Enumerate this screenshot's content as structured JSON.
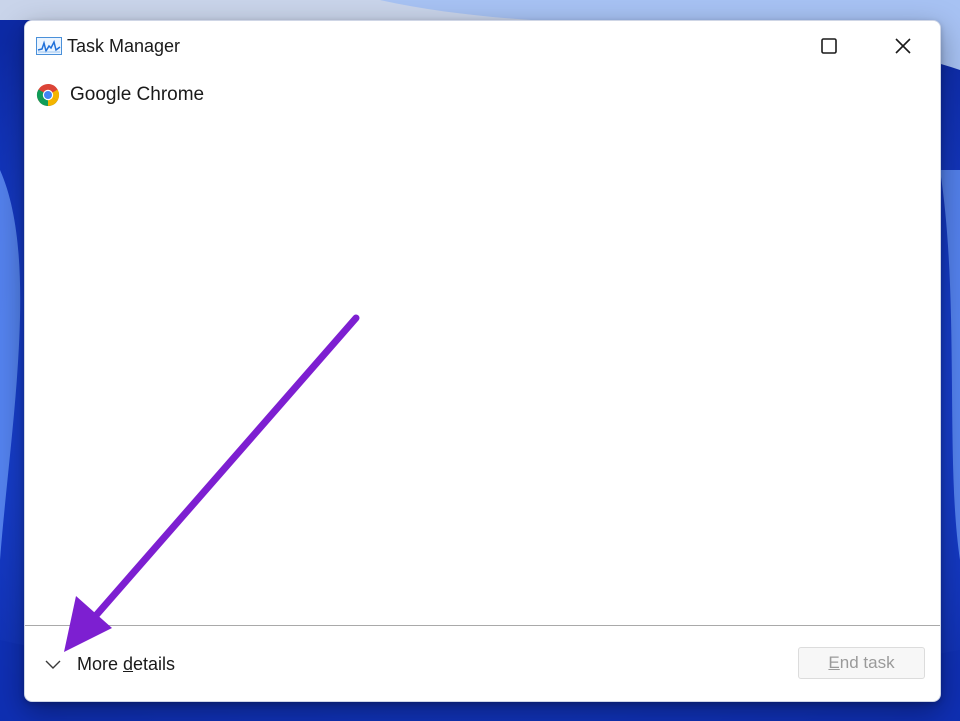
{
  "window": {
    "title": "Task Manager",
    "app_icon": "performance-graph-icon",
    "controls": [
      "minimize-icon",
      "maximize-icon",
      "close-icon"
    ]
  },
  "processes": [
    {
      "name": "Google Chrome",
      "icon": "chrome-icon"
    }
  ],
  "footer": {
    "more_details_prefix": "More ",
    "more_details_mnemonic": "d",
    "more_details_suffix": "etails",
    "end_task_mnemonic": "E",
    "end_task_suffix": "nd task",
    "end_task_enabled": false,
    "chevron_icon": "chevron-down-icon"
  },
  "annotation": {
    "type": "arrow",
    "color": "#7d1fd1",
    "points_to": "more-details-button"
  },
  "colors": {
    "wallpaper": "#1b3fd6",
    "window_bg": "#ffffff",
    "divider": "#a9a9a9",
    "disabled_text": "#9a9a9a"
  }
}
